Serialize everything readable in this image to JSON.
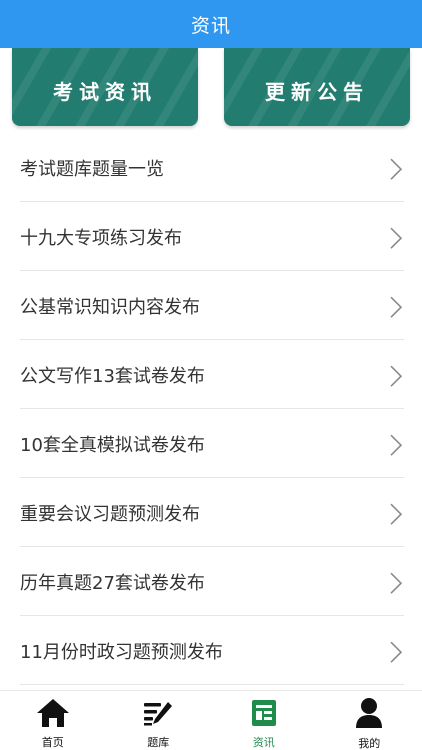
{
  "header": {
    "title": "资讯"
  },
  "cards": [
    {
      "label": "考试资讯"
    },
    {
      "label": "更新公告"
    }
  ],
  "news": [
    {
      "title": "考试题库题量一览"
    },
    {
      "title": "十九大专项练习发布"
    },
    {
      "title": "公基常识知识内容发布"
    },
    {
      "title": "公文写作13套试卷发布"
    },
    {
      "title": "10套全真模拟试卷发布"
    },
    {
      "title": "重要会议习题预测发布"
    },
    {
      "title": "历年真题27套试卷发布"
    },
    {
      "title": "11月份时政习题预测发布"
    }
  ],
  "tabbar": {
    "items": [
      {
        "label": "首页",
        "icon": "home-icon"
      },
      {
        "label": "题库",
        "icon": "pen-lines-icon"
      },
      {
        "label": "资讯",
        "icon": "news-icon",
        "active": true
      },
      {
        "label": "我的",
        "icon": "user-icon"
      }
    ]
  },
  "colors": {
    "header_bg": "#2f97f0",
    "card_bg": "#227d70",
    "active_tab": "#1f8c4c"
  }
}
